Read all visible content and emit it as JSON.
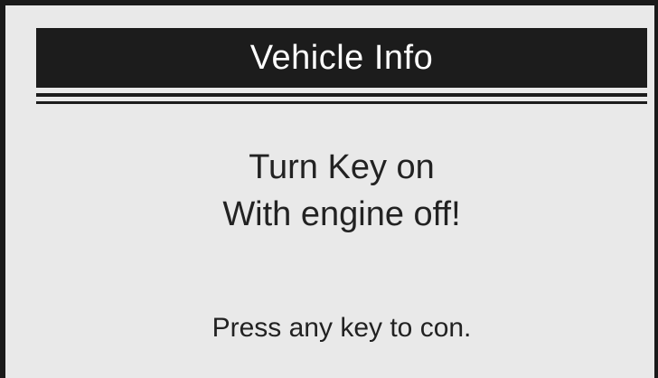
{
  "header": {
    "title": "Vehicle Info"
  },
  "message": {
    "line1": "Turn Key on",
    "line2": "With engine off!"
  },
  "footer": {
    "prompt": "Press any key to con."
  },
  "colors": {
    "background": "#e9e9e9",
    "title_bar": "#1c1c1c",
    "title_text": "#ffffff",
    "text": "#222222"
  }
}
